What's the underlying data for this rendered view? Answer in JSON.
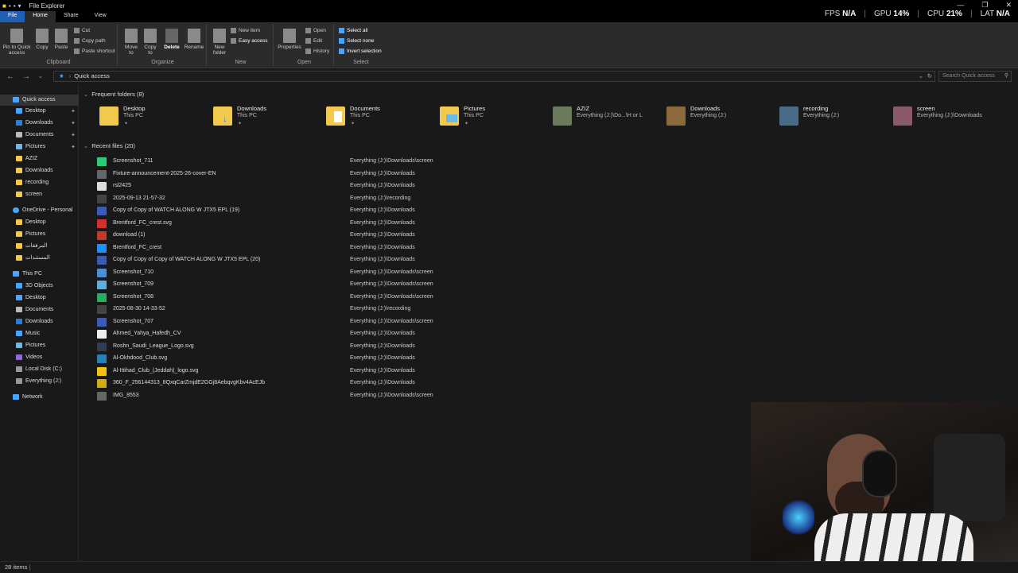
{
  "window": {
    "title": "File Explorer",
    "controls": [
      "—",
      "❐",
      "✕"
    ]
  },
  "perf": {
    "fps_label": "FPS",
    "fps_value": "N/A",
    "gpu_label": "GPU",
    "gpu_value": "14%",
    "cpu_label": "CPU",
    "cpu_value": "21%",
    "lat_label": "LAT",
    "lat_value": "N/A"
  },
  "tabs": [
    "File",
    "Home",
    "Share",
    "View"
  ],
  "ribbon": {
    "clipboard": {
      "label": "Clipboard",
      "pin": "Pin to Quick access",
      "copy": "Copy",
      "paste": "Paste",
      "cut": "Cut",
      "copy_path": "Copy path",
      "paste_shortcut": "Paste shortcut"
    },
    "organize": {
      "label": "Organize",
      "move_to": "Move to",
      "copy_to": "Copy to",
      "delete": "Delete",
      "rename": "Rename"
    },
    "new": {
      "label": "New",
      "new_folder": "New folder",
      "new_item": "New item",
      "easy_access": "Easy access"
    },
    "open": {
      "label": "Open",
      "properties": "Properties",
      "open": "Open",
      "edit": "Edit",
      "history": "History"
    },
    "select": {
      "label": "Select",
      "select_all": "Select all",
      "select_none": "Select none",
      "invert_selection": "Invert selection"
    }
  },
  "address": {
    "path": "Quick access",
    "search_placeholder": "Search Quick access"
  },
  "sidebar": {
    "quick_access": "Quick access",
    "qa_items": [
      "Desktop",
      "Downloads",
      "Documents",
      "Pictures",
      "AZIZ",
      "Downloads",
      "recording",
      "screen"
    ],
    "onedrive": "OneDrive - Personal",
    "od_items": [
      "Desktop",
      "Pictures",
      "المرفقات",
      "المستندات"
    ],
    "this_pc": "This PC",
    "pc_items": [
      "3D Objects",
      "Desktop",
      "Documents",
      "Downloads",
      "Music",
      "Pictures",
      "Videos",
      "Local Disk (C:)",
      "Everything (J:)"
    ],
    "network": "Network"
  },
  "frequent": {
    "header": "Frequent folders (8)",
    "items": [
      {
        "name": "Desktop",
        "loc": "This PC"
      },
      {
        "name": "Downloads",
        "loc": "This PC"
      },
      {
        "name": "Documents",
        "loc": "This PC"
      },
      {
        "name": "Pictures",
        "loc": "This PC"
      },
      {
        "name": "AZIZ",
        "loc": "Everything (J:)\\Do...\\H or L"
      },
      {
        "name": "Downloads",
        "loc": "Everything (J:)"
      },
      {
        "name": "recording",
        "loc": "Everything (J:)"
      },
      {
        "name": "screen",
        "loc": "Everything (J:)\\Downloads"
      }
    ]
  },
  "recent": {
    "header": "Recent files (20)",
    "items": [
      {
        "name": "Screenshot_711",
        "path": "Everything (J:)\\Downloads\\screen",
        "color": "#2ecc71"
      },
      {
        "name": "Fixture-announcement-2025-26-cover-EN",
        "path": "Everything (J:)\\Downloads",
        "color": "#666666"
      },
      {
        "name": "rsl2425",
        "path": "Everything (J:)\\Downloads",
        "color": "#dddddd"
      },
      {
        "name": "2025-09-13 21-57-32",
        "path": "Everything (J:)\\recording",
        "color": "#444444"
      },
      {
        "name": "Copy of Copy of WATCH ALONG W JTX5  EPL (19)",
        "path": "Everything (J:)\\Downloads",
        "color": "#3b5bb5"
      },
      {
        "name": "Brentford_FC_crest.svg",
        "path": "Everything (J:)\\Downloads",
        "color": "#d0312d"
      },
      {
        "name": "download (1)",
        "path": "Everything (J:)\\Downloads",
        "color": "#c0392b"
      },
      {
        "name": "Brentford_FC_crest",
        "path": "Everything (J:)\\Downloads",
        "color": "#1e90ff"
      },
      {
        "name": "Copy of Copy of Copy of WATCH ALONG W JTX5  EPL (20)",
        "path": "Everything (J:)\\Downloads",
        "color": "#3b5bb5"
      },
      {
        "name": "Screenshot_710",
        "path": "Everything (J:)\\Downloads\\screen",
        "color": "#4a90d9"
      },
      {
        "name": "Screenshot_709",
        "path": "Everything (J:)\\Downloads\\screen",
        "color": "#5dade2"
      },
      {
        "name": "Screenshot_708",
        "path": "Everything (J:)\\Downloads\\screen",
        "color": "#27ae60"
      },
      {
        "name": "2025-08-30 14-33-52",
        "path": "Everything (J:)\\recording",
        "color": "#444444"
      },
      {
        "name": "Screenshot_707",
        "path": "Everything (J:)\\Downloads\\screen",
        "color": "#3b5bb5"
      },
      {
        "name": "Ahmed_Yahya_Hafedh_CV",
        "path": "Everything (J:)\\Downloads",
        "color": "#eeeeee"
      },
      {
        "name": "Roshn_Saudi_League_Logo.svg",
        "path": "Everything (J:)\\Downloads",
        "color": "#2c3e50"
      },
      {
        "name": "Al-Okhdood_Club.svg",
        "path": "Everything (J:)\\Downloads",
        "color": "#2980b9"
      },
      {
        "name": "Al-Ittihad_Club_(Jeddah)_logo.svg",
        "path": "Everything (J:)\\Downloads",
        "color": "#f1c40f"
      },
      {
        "name": "360_F_256144313_8QxqCarZmjdE2GGj8AebqvgKbv4AcEJb",
        "path": "Everything (J:)\\Downloads",
        "color": "#d4ac0d"
      },
      {
        "name": "IMG_8553",
        "path": "Everything (J:)\\Downloads\\screen",
        "color": "#666666"
      }
    ]
  },
  "status": {
    "count": "28 items"
  }
}
